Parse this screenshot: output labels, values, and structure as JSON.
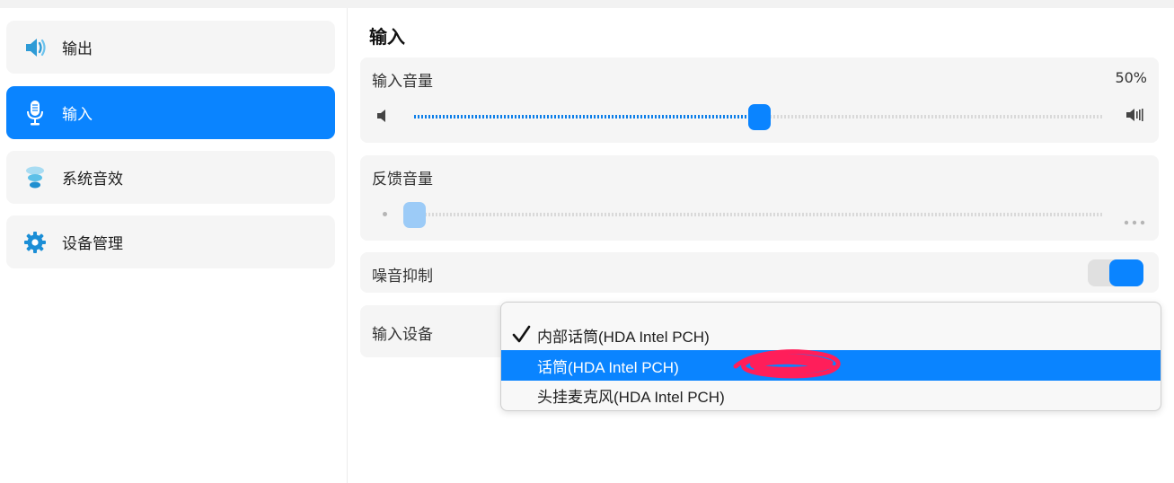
{
  "sidebar": {
    "items": [
      {
        "label": "输出",
        "icon": "speaker-icon"
      },
      {
        "label": "输入",
        "icon": "microphone-icon",
        "active": true
      },
      {
        "label": "系统音效",
        "icon": "sound-effect-icon"
      },
      {
        "label": "设备管理",
        "icon": "gear-icon"
      }
    ]
  },
  "main": {
    "title": "输入",
    "input_volume": {
      "label": "输入音量",
      "value_text": "50%",
      "value": 0.5
    },
    "feedback_volume": {
      "label": "反馈音量",
      "value": 0.0,
      "enabled": false
    },
    "noise_suppression": {
      "label": "噪音抑制",
      "enabled": true
    },
    "input_device": {
      "label": "输入设备",
      "options": [
        {
          "label": "内部话筒(HDA Intel PCH)",
          "checked": true
        },
        {
          "label": "话筒(HDA Intel PCH)",
          "highlighted": true
        },
        {
          "label": "头挂麦克风(HDA Intel PCH)"
        }
      ]
    }
  },
  "colors": {
    "accent": "#0a84ff",
    "annotation": "#ff1e5a"
  }
}
